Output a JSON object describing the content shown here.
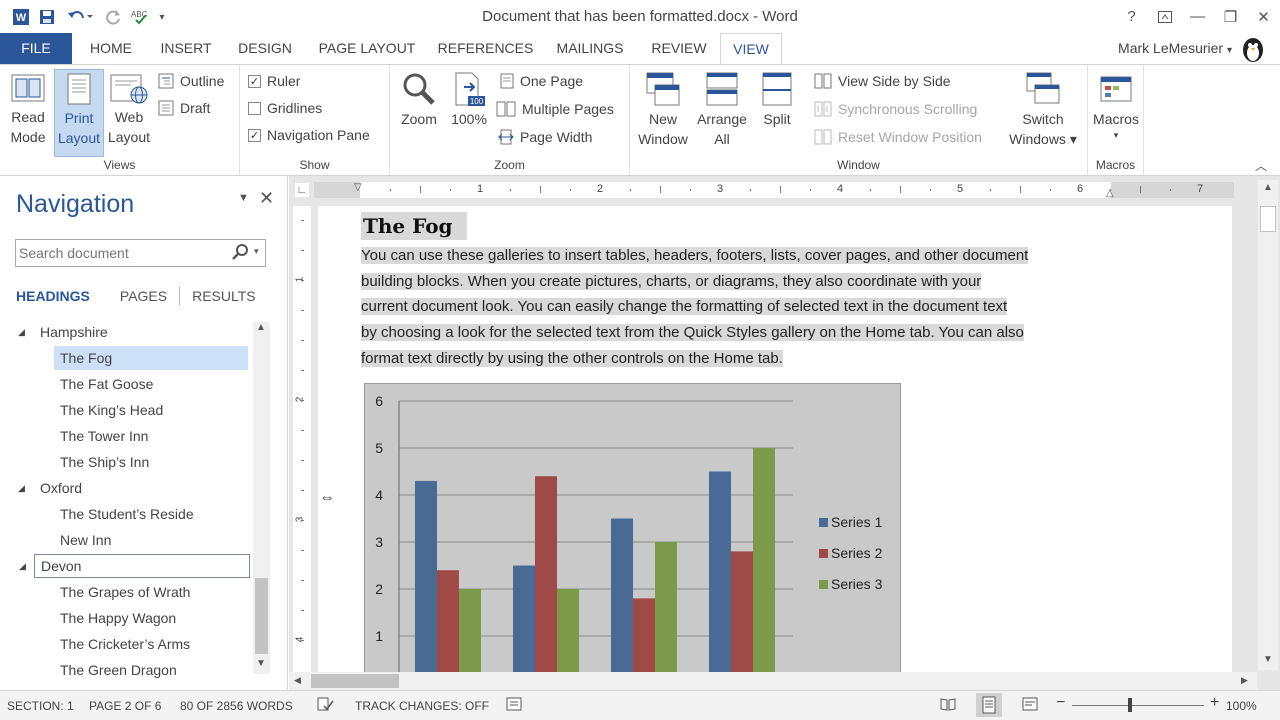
{
  "titlebar": {
    "title": "Document that has been formatted.docx - Word",
    "help": "?",
    "minimize": "—",
    "restore": "❐",
    "close": "✕"
  },
  "tabs": [
    "FILE",
    "HOME",
    "INSERT",
    "DESIGN",
    "PAGE LAYOUT",
    "REFERENCES",
    "MAILINGS",
    "REVIEW",
    "VIEW"
  ],
  "active_tab": "VIEW",
  "user": "Mark LeMesurier",
  "ribbon": {
    "views": {
      "label": "Views",
      "read_mode": [
        "Read",
        "Mode"
      ],
      "print_layout": [
        "Print",
        "Layout"
      ],
      "web_layout": [
        "Web",
        "Layout"
      ],
      "outline": "Outline",
      "draft": "Draft"
    },
    "show": {
      "label": "Show",
      "ruler": "Ruler",
      "gridlines": "Gridlines",
      "nav_pane": "Navigation Pane",
      "ruler_checked": true,
      "gridlines_checked": false,
      "nav_checked": true
    },
    "zoom": {
      "label": "Zoom",
      "zoom": "Zoom",
      "hundred": "100%",
      "one_page": "One Page",
      "multiple_pages": "Multiple Pages",
      "page_width": "Page Width",
      "badge": "100"
    },
    "window": {
      "label": "Window",
      "new_window": [
        "New",
        "Window"
      ],
      "arrange_all": [
        "Arrange",
        "All"
      ],
      "split": "Split",
      "view_side": "View Side by Side",
      "sync_scroll": "Synchronous Scrolling",
      "reset_pos": "Reset Window Position",
      "switch": [
        "Switch",
        "Windows ▾"
      ]
    },
    "macros": {
      "label": "Macros",
      "macros": "Macros"
    }
  },
  "navigation": {
    "title": "Navigation",
    "search_placeholder": "Search document",
    "tabs": [
      "HEADINGS",
      "PAGES",
      "RESULTS"
    ],
    "tree": [
      {
        "label": "Hampshire",
        "level": 0,
        "expanded": true
      },
      {
        "label": "The Fog",
        "level": 1,
        "selected": true
      },
      {
        "label": "The Fat Goose",
        "level": 1
      },
      {
        "label": "The King’s Head",
        "level": 1
      },
      {
        "label": "The Tower Inn",
        "level": 1
      },
      {
        "label": "The Ship’s Inn",
        "level": 1
      },
      {
        "label": "Oxford",
        "level": 0,
        "expanded": true
      },
      {
        "label": "The Student’s Reside",
        "level": 1
      },
      {
        "label": "New Inn",
        "level": 1
      },
      {
        "label": "Devon",
        "level": 0,
        "expanded": true,
        "focused": true
      },
      {
        "label": "The Grapes of Wrath",
        "level": 1
      },
      {
        "label": "The Happy Wagon",
        "level": 1
      },
      {
        "label": "The Cricketer’s Arms",
        "level": 1
      },
      {
        "label": "The Green Dragon",
        "level": 1
      }
    ]
  },
  "ruler_numbers": [
    "1",
    "2",
    "3",
    "4",
    "5",
    "6",
    "7"
  ],
  "vruler_numbers": [
    "1",
    "2",
    "3",
    "4"
  ],
  "document": {
    "heading": "The Fog",
    "lines": [
      "You can use these galleries to insert tables, headers, footers, lists, cover pages, and other document",
      "building blocks. When you create pictures, charts, or diagrams, they also coordinate with your",
      "current document look. You can easily change the formatting of selected text in the document text",
      "by choosing a look for the selected text from the Quick Styles gallery on the Home tab. You can also",
      "format text directly by using the other controls on the Home tab."
    ]
  },
  "chart_data": {
    "type": "bar",
    "categories": [
      "",
      "",
      "",
      ""
    ],
    "series": [
      {
        "name": "Series 1",
        "color": "#4a6a96",
        "values": [
          4.3,
          2.5,
          3.5,
          4.5
        ]
      },
      {
        "name": "Series 2",
        "color": "#a04a48",
        "values": [
          2.4,
          4.4,
          1.8,
          2.8
        ]
      },
      {
        "name": "Series 3",
        "color": "#7d9a4a",
        "values": [
          2.0,
          2.0,
          3.0,
          5.0
        ]
      }
    ],
    "yticks": [
      "1",
      "2",
      "3",
      "4",
      "5",
      "6"
    ],
    "ylim": [
      0,
      6
    ],
    "grid": true,
    "legend": "right"
  },
  "status": {
    "section": "SECTION: 1",
    "page": "PAGE 2 OF 6",
    "words": "80 OF 2856 WORDS",
    "track": "TRACK CHANGES: OFF",
    "zoom": "100%",
    "minus": "−",
    "plus": "+"
  },
  "colors": {
    "accent": "#2b579a",
    "selection": "#cde0f7"
  }
}
